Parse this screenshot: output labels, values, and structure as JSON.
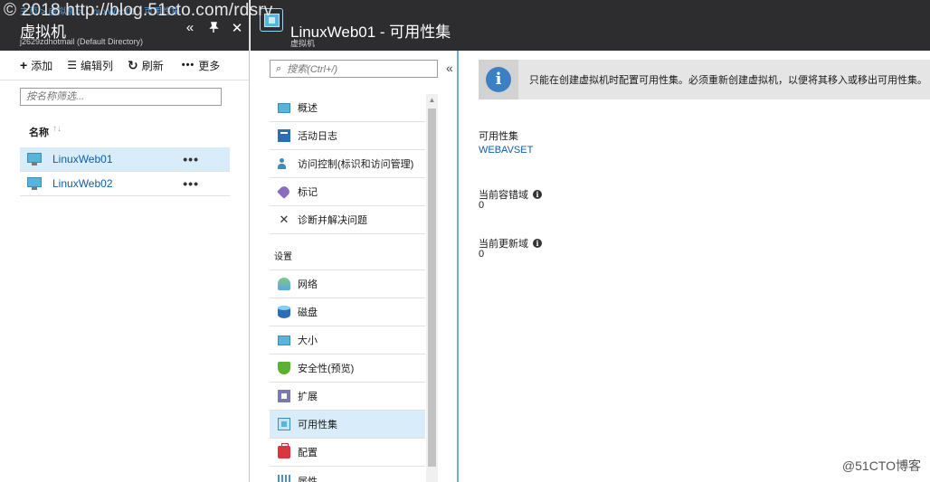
{
  "watermark": {
    "top": "© 2018 http://blog.51cto.com/rdsrv",
    "bottom": "@51CTO博客"
  },
  "left_blade": {
    "breadcrumb": "主页 > 虚拟机 > LinuxWeb01 - 可用性集",
    "title": "虚拟机",
    "subtitle": "j2629zdhotmail (Default Directory)",
    "controls": {
      "collapse": "«",
      "pin": "📌",
      "close": "✕"
    },
    "toolbar": {
      "add": "添加",
      "add_icon": "plus-icon",
      "edit_columns": "编辑列",
      "edit_columns_icon": "columns-icon",
      "refresh": "刷新",
      "refresh_icon": "refresh-icon",
      "more": "更多",
      "more_icon": "ellipsis-icon"
    },
    "filter_placeholder": "按名称筛选...",
    "column_header": "名称",
    "sort_glyph": "↑↓",
    "vms": [
      {
        "name": "LinuxWeb01",
        "more": "•••",
        "selected": true
      },
      {
        "name": "LinuxWeb02",
        "more": "•••",
        "selected": false
      }
    ]
  },
  "right_blade": {
    "title": "LinuxWeb01 - 可用性集",
    "subtitle": "虚拟机",
    "search_placeholder": "搜索(Ctrl+/)",
    "collapse": "«",
    "menu": {
      "items_top": [
        {
          "label": "概述",
          "icon": "monitor-icon"
        },
        {
          "label": "活动日志",
          "icon": "activity-log-icon"
        },
        {
          "label": "访问控制(标识和访问管理)",
          "icon": "people-icon"
        },
        {
          "label": "标记",
          "icon": "tag-icon"
        },
        {
          "label": "诊断并解决问题",
          "icon": "tools-icon"
        }
      ],
      "section_settings": "设置",
      "items_settings": [
        {
          "label": "网络",
          "icon": "network-icon"
        },
        {
          "label": "磁盘",
          "icon": "disk-icon"
        },
        {
          "label": "大小",
          "icon": "monitor-icon"
        },
        {
          "label": "安全性(预览)",
          "icon": "shield-icon"
        },
        {
          "label": "扩展",
          "icon": "extensions-icon"
        },
        {
          "label": "可用性集",
          "icon": "availability-set-icon",
          "selected": true
        },
        {
          "label": "配置",
          "icon": "configuration-icon"
        },
        {
          "label": "属性",
          "icon": "properties-icon"
        }
      ]
    },
    "content": {
      "info_icon": "i",
      "info_text": "只能在创建虚拟机时配置可用性集。必须重新创建虚拟机，以便将其移入或移出可用性集。",
      "availability_set_label": "可用性集",
      "availability_set_value": "WEBAVSET",
      "fault_domain_label": "当前容错域",
      "fault_domain_value": "0",
      "update_domain_label": "当前更新域",
      "update_domain_value": "0"
    }
  },
  "colors": {
    "header_bg": "#2d2d30",
    "accent": "#0f5ea8",
    "selected_row": "#d9ecf9"
  }
}
